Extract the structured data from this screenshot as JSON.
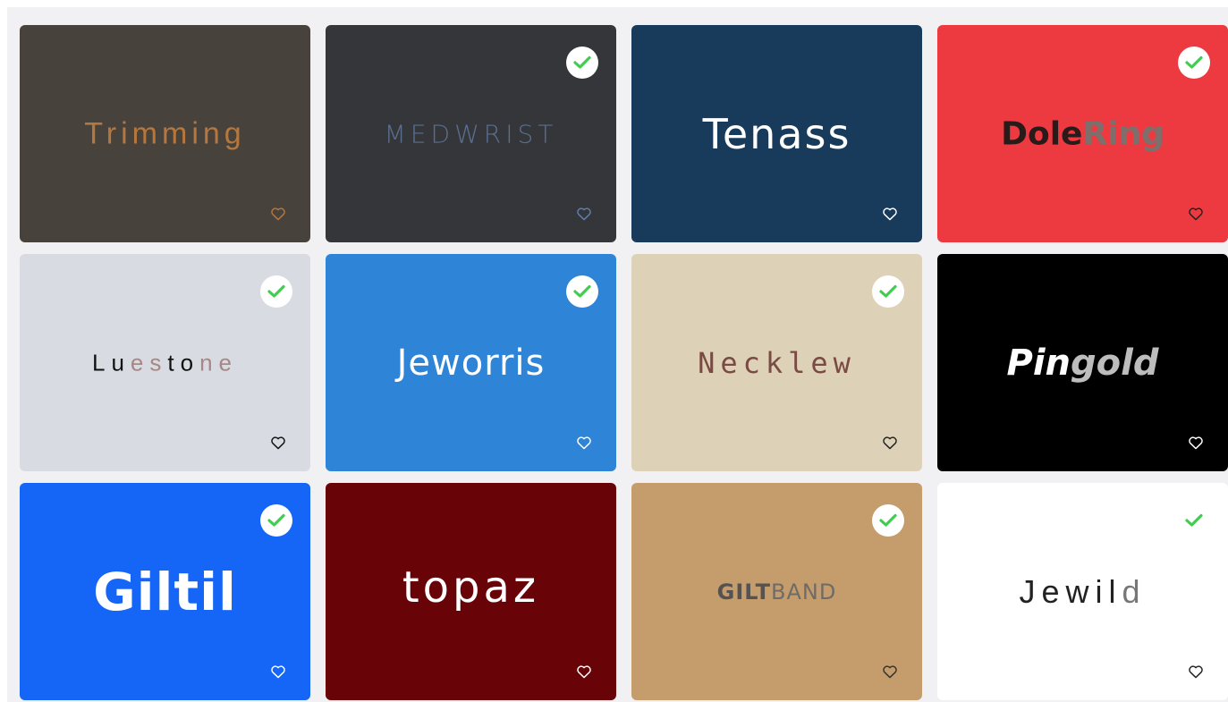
{
  "cards": [
    {
      "name": "Trimming",
      "bg": "#48423d",
      "selected": false,
      "heart_color": "#b5773c",
      "logo_color": "#b5773c"
    },
    {
      "name": "MEDWRIST",
      "bg": "#35363a",
      "selected": true,
      "heart_color": "#5f7fae",
      "logo_color": "#5a6f8f"
    },
    {
      "name": "Tenass",
      "bg": "#183a5b",
      "selected": false,
      "heart_color": "#ffffff",
      "logo_color": "#ffffff"
    },
    {
      "name_part1": "Dole",
      "name_part2": "Ring",
      "bg": "#ec3a40",
      "selected": true,
      "heart_color": "#222222",
      "logo_color": "#2a1a1a",
      "logo_color2": "#7e6f6c"
    },
    {
      "letters": [
        "L",
        "u",
        "e",
        "s",
        "t",
        "o",
        "n",
        "e"
      ],
      "bg": "#d8dbe1",
      "selected": true,
      "heart_color": "#111111"
    },
    {
      "name": "Jeworris",
      "bg": "#2e84d6",
      "selected": true,
      "heart_color": "#ffffff",
      "logo_color": "#ffffff"
    },
    {
      "name": "Necklew",
      "bg": "#ddd2b7",
      "selected": true,
      "heart_color": "#222222",
      "logo_color": "#7a4a44"
    },
    {
      "name_part1": "Pin",
      "name_part2": "gold",
      "bg": "#000000",
      "selected": false,
      "heart_color": "#ffffff",
      "logo_color": "#ffffff",
      "logo_color2": "#bdbdbd"
    },
    {
      "name": "Giltil",
      "bg": "#1565f7",
      "selected": true,
      "heart_color": "#ffffff",
      "logo_color": "#ffffff"
    },
    {
      "name": "topaz",
      "bg": "#680307",
      "selected": false,
      "heart_color": "#ffffff",
      "logo_color": "#ffffff"
    },
    {
      "name_part1": "GILT",
      "name_part2": "BAND",
      "bg": "#c59d6c",
      "selected": true,
      "heart_color": "#333333",
      "logo_color": "#555252",
      "logo_color2": "#6f6b66"
    },
    {
      "name_part1": "Jewil",
      "name_part2": "d",
      "bg": "#ffffff",
      "selected": true,
      "check_plain": true,
      "heart_color": "#222222",
      "logo_color": "#222222",
      "logo_color2": "#777777"
    }
  ],
  "colors": {
    "check_green": "#3fce50",
    "page_bg": "#f1f1f3"
  }
}
